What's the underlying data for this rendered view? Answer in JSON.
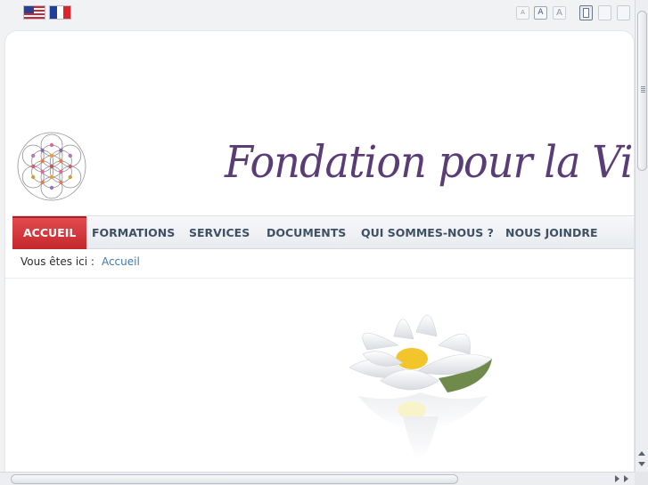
{
  "languages": [
    {
      "code": "en",
      "icon": "us-flag-icon"
    },
    {
      "code": "fr",
      "icon": "france-flag-icon"
    }
  ],
  "font_size_buttons": [
    "A",
    "A",
    "A"
  ],
  "site": {
    "title": "Fondation pour la Vie"
  },
  "nav": {
    "items": [
      {
        "label": "ACCUEIL",
        "active": true
      },
      {
        "label": "FORMATIONS",
        "active": false
      },
      {
        "label": "SERVICES",
        "active": false
      },
      {
        "label": "DOCUMENTS",
        "active": false
      },
      {
        "label": "QUI SOMMES-NOUS ?",
        "active": false
      },
      {
        "label": "NOUS JOINDRE",
        "active": false
      }
    ]
  },
  "breadcrumb": {
    "prefix": "Vous êtes ici :",
    "current": "Accueil"
  },
  "colors": {
    "accent": "#c4282d",
    "title": "#5a3d76",
    "link": "#3d78b8",
    "nav_text": "#3f5064"
  }
}
